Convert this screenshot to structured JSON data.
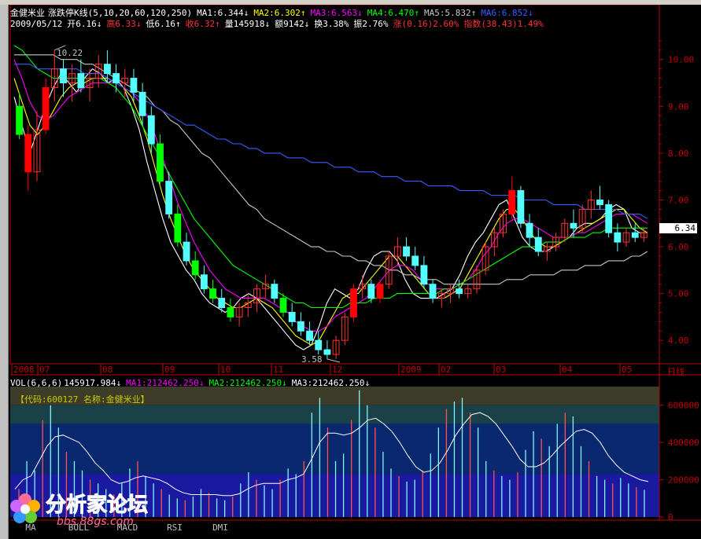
{
  "header": {
    "name": "金健米业",
    "indicator": "涨跌停K线",
    "params": "(5,10,20,60,120,250)",
    "ma1": "MA1:6.344↓",
    "ma2": "MA2:6.302↑",
    "ma3": "MA3:6.563↓",
    "ma4": "MA4:6.470↑",
    "ma5": "MA5:5.832↑",
    "ma6": "MA6:6.852↓",
    "date": "2009/05/12",
    "open": "开6.16↓",
    "high": "高6.33↓",
    "low": "低6.16↑",
    "close": "收6.32↑",
    "volume": "量145918↓",
    "amount": "额9142↓",
    "turnover": "换3.38%",
    "amplitude": "振2.76%",
    "change": "涨(0.16)2.60%",
    "index": "指数(38.43)1.49%"
  },
  "vol_header": {
    "label": "VOL(6,6,6)",
    "value": "145917.984↓",
    "ma1": "MA1:212462.250↓",
    "ma2": "MA2:212462.250↓",
    "ma3": "MA3:212462.250↓"
  },
  "code_label": "【代码:600127 名称:金健米业】",
  "current_price_label": "6.34",
  "max_label": "10.22",
  "min_label": "3.58",
  "period_label": "日线",
  "tabs": [
    "MA",
    "BOLL",
    "MACD",
    "RSI",
    "DMI"
  ],
  "logo": {
    "title": "分析家论坛",
    "url": "bbs.88gs.com"
  },
  "colors": {
    "ma1": "#ffffff",
    "ma2": "#ffff00",
    "ma3": "#ff00ff",
    "ma4": "#00ff00",
    "ma5": "#c8c8c8",
    "ma6": "#3a5cff",
    "up": "#ff3232",
    "down": "#54ffff",
    "limit_up": "#ff0000",
    "limit_down": "#00ff00",
    "axis": "#c00000"
  },
  "chart_data": [
    {
      "type": "candlestick",
      "title": "金健米业 涨跌停K线",
      "ylim": [
        3.5,
        10.6
      ],
      "yticks": [
        4.0,
        5.0,
        6.0,
        7.0,
        8.0,
        9.0,
        10.0
      ],
      "x_labels": [
        "2008",
        "07",
        "08",
        "09",
        "10",
        "11",
        "12",
        "2009",
        "02",
        "03",
        "04",
        "05"
      ],
      "ma_series": [
        {
          "name": "MA1",
          "values": [
            9.2,
            8.6,
            8.0,
            8.5,
            9.0,
            9.4,
            9.7,
            9.5,
            9.3,
            9.6,
            9.8,
            9.7,
            9.5,
            9.6,
            9.4,
            9.0,
            8.5,
            7.8,
            7.2,
            6.6,
            6.1,
            5.8,
            5.5,
            5.3,
            5.0,
            4.8,
            4.7,
            4.6,
            4.7,
            4.9,
            5.0,
            4.9,
            4.7,
            4.5,
            4.3,
            4.1,
            3.9,
            3.8,
            3.9,
            4.3,
            4.8,
            5.1,
            5.0,
            4.9,
            5.1,
            5.5,
            5.8,
            5.9,
            5.9,
            5.7,
            5.3,
            5.0,
            4.9,
            4.9,
            4.9,
            5.0,
            5.1,
            5.4,
            5.8,
            6.1,
            6.3,
            6.6,
            6.9,
            7.0,
            6.6,
            6.2,
            6.0,
            5.9,
            5.9,
            6.0,
            6.1,
            6.2,
            6.4,
            6.5,
            6.5,
            6.6,
            6.8,
            6.9,
            6.8,
            6.4,
            6.3,
            6.3
          ]
        },
        {
          "name": "MA2",
          "values": [
            9.6,
            9.1,
            8.6,
            8.4,
            8.6,
            8.9,
            9.2,
            9.4,
            9.5,
            9.5,
            9.6,
            9.6,
            9.6,
            9.5,
            9.4,
            9.2,
            8.8,
            8.3,
            7.7,
            7.1,
            6.6,
            6.2,
            5.8,
            5.5,
            5.3,
            5.1,
            4.9,
            4.8,
            4.7,
            4.7,
            4.8,
            4.9,
            4.8,
            4.7,
            4.5,
            4.3,
            4.1,
            4.0,
            3.9,
            4.0,
            4.3,
            4.6,
            4.9,
            5.0,
            5.0,
            5.2,
            5.4,
            5.6,
            5.8,
            5.8,
            5.6,
            5.4,
            5.2,
            5.0,
            4.9,
            4.9,
            5.0,
            5.1,
            5.4,
            5.7,
            6.0,
            6.3,
            6.6,
            6.8,
            6.8,
            6.6,
            6.3,
            6.1,
            6.0,
            6.0,
            6.1,
            6.2,
            6.3,
            6.4,
            6.5,
            6.6,
            6.7,
            6.8,
            6.8,
            6.6,
            6.4,
            6.3
          ]
        },
        {
          "name": "MA3",
          "values": [
            10.0,
            9.6,
            9.1,
            8.8,
            8.7,
            8.8,
            9.0,
            9.2,
            9.3,
            9.4,
            9.5,
            9.5,
            9.5,
            9.5,
            9.4,
            9.3,
            9.1,
            8.8,
            8.4,
            7.9,
            7.4,
            6.9,
            6.5,
            6.1,
            5.8,
            5.5,
            5.3,
            5.1,
            5.0,
            4.9,
            4.9,
            4.9,
            4.9,
            4.8,
            4.7,
            4.6,
            4.4,
            4.3,
            4.2,
            4.2,
            4.3,
            4.5,
            4.6,
            4.7,
            4.8,
            4.9,
            5.1,
            5.3,
            5.5,
            5.6,
            5.6,
            5.5,
            5.3,
            5.2,
            5.1,
            5.1,
            5.1,
            5.2,
            5.3,
            5.5,
            5.8,
            6.0,
            6.3,
            6.5,
            6.6,
            6.6,
            6.5,
            6.4,
            6.3,
            6.2,
            6.2,
            6.2,
            6.3,
            6.3,
            6.4,
            6.5,
            6.6,
            6.7,
            6.7,
            6.7,
            6.6,
            6.5
          ]
        },
        {
          "name": "MA4",
          "values": [
            10.3,
            10.2,
            10.0,
            9.8,
            9.7,
            9.6,
            9.6,
            9.6,
            9.6,
            9.6,
            9.6,
            9.6,
            9.5,
            9.4,
            9.2,
            9.0,
            8.7,
            8.4,
            8.1,
            7.8,
            7.5,
            7.2,
            6.9,
            6.6,
            6.4,
            6.2,
            6.0,
            5.8,
            5.6,
            5.5,
            5.4,
            5.3,
            5.2,
            5.1,
            5.0,
            4.9,
            4.8,
            4.8,
            4.7,
            4.7,
            4.7,
            4.7,
            4.7,
            4.8,
            4.8,
            4.8,
            4.9,
            4.9,
            4.9,
            5.0,
            5.0,
            5.0,
            5.0,
            5.0,
            5.0,
            5.1,
            5.1,
            5.2,
            5.3,
            5.4,
            5.5,
            5.6,
            5.7,
            5.8,
            5.9,
            6.0,
            6.0,
            6.0,
            6.1,
            6.1,
            6.1,
            6.2,
            6.2,
            6.2,
            6.3,
            6.3,
            6.4,
            6.4,
            6.4,
            6.4,
            6.4,
            6.4
          ]
        },
        {
          "name": "MA5",
          "values": [
            10.1,
            10.1,
            10.1,
            10.1,
            10.1,
            10.1,
            10.0,
            10.0,
            10.0,
            9.9,
            9.9,
            9.8,
            9.7,
            9.6,
            9.5,
            9.4,
            9.3,
            9.2,
            9.0,
            8.9,
            8.7,
            8.6,
            8.4,
            8.2,
            8.0,
            7.9,
            7.7,
            7.5,
            7.3,
            7.1,
            6.9,
            6.8,
            6.6,
            6.5,
            6.4,
            6.3,
            6.2,
            6.1,
            6.0,
            6.0,
            5.9,
            5.9,
            5.8,
            5.8,
            5.7,
            5.7,
            5.6,
            5.6,
            5.5,
            5.5,
            5.4,
            5.4,
            5.3,
            5.3,
            5.3,
            5.2,
            5.2,
            5.2,
            5.2,
            5.2,
            5.2,
            5.2,
            5.2,
            5.3,
            5.3,
            5.3,
            5.4,
            5.4,
            5.4,
            5.4,
            5.5,
            5.5,
            5.5,
            5.6,
            5.6,
            5.6,
            5.7,
            5.7,
            5.7,
            5.8,
            5.8,
            5.9
          ]
        },
        {
          "name": "MA6",
          "values": [
            9.9,
            9.9,
            9.9,
            9.8,
            9.8,
            9.8,
            9.8,
            9.8,
            9.8,
            9.7,
            9.7,
            9.7,
            9.6,
            9.5,
            9.4,
            9.3,
            9.2,
            9.1,
            9.0,
            8.9,
            8.8,
            8.7,
            8.6,
            8.6,
            8.5,
            8.4,
            8.3,
            8.3,
            8.2,
            8.2,
            8.1,
            8.1,
            8.0,
            8.0,
            8.0,
            7.9,
            7.9,
            7.9,
            7.8,
            7.8,
            7.8,
            7.7,
            7.7,
            7.7,
            7.6,
            7.6,
            7.6,
            7.5,
            7.5,
            7.5,
            7.4,
            7.4,
            7.4,
            7.3,
            7.3,
            7.3,
            7.3,
            7.2,
            7.2,
            7.2,
            7.2,
            7.1,
            7.1,
            7.1,
            7.1,
            7.0,
            7.0,
            7.0,
            7.0,
            6.9,
            6.9,
            6.9,
            6.9,
            6.8,
            6.8,
            6.8,
            6.8,
            6.8,
            6.7,
            6.7,
            6.7,
            6.6
          ]
        }
      ],
      "candles": [
        [
          9.0,
          9.3,
          8.3,
          8.4
        ],
        [
          8.4,
          8.6,
          7.2,
          7.6
        ],
        [
          7.6,
          8.9,
          7.4,
          8.5
        ],
        [
          8.5,
          9.6,
          8.4,
          9.4
        ],
        [
          9.4,
          10.2,
          9.1,
          9.8
        ],
        [
          9.8,
          10.0,
          9.2,
          9.5
        ],
        [
          9.5,
          9.9,
          9.1,
          9.7
        ],
        [
          9.7,
          10.0,
          9.3,
          9.4
        ],
        [
          9.4,
          9.8,
          9.1,
          9.6
        ],
        [
          9.6,
          10.1,
          9.4,
          9.9
        ],
        [
          9.9,
          10.2,
          9.5,
          9.7
        ],
        [
          9.7,
          9.9,
          9.3,
          9.5
        ],
        [
          9.5,
          9.8,
          9.2,
          9.6
        ],
        [
          9.6,
          9.8,
          9.1,
          9.3
        ],
        [
          9.3,
          9.5,
          8.6,
          8.8
        ],
        [
          8.8,
          9.0,
          8.0,
          8.2
        ],
        [
          8.2,
          8.4,
          7.3,
          7.4
        ],
        [
          7.4,
          7.6,
          6.6,
          6.7
        ],
        [
          6.7,
          6.9,
          6.0,
          6.1
        ],
        [
          6.1,
          6.3,
          5.6,
          5.7
        ],
        [
          5.7,
          5.9,
          5.3,
          5.4
        ],
        [
          5.4,
          5.6,
          5.0,
          5.1
        ],
        [
          5.1,
          5.3,
          4.8,
          4.9
        ],
        [
          4.9,
          5.1,
          4.6,
          4.7
        ],
        [
          4.7,
          4.9,
          4.4,
          4.5
        ],
        [
          4.5,
          4.8,
          4.3,
          4.7
        ],
        [
          4.7,
          5.0,
          4.5,
          4.8
        ],
        [
          4.8,
          5.2,
          4.6,
          5.1
        ],
        [
          5.1,
          5.4,
          4.9,
          5.2
        ],
        [
          5.2,
          5.3,
          4.8,
          4.9
        ],
        [
          4.9,
          5.0,
          4.5,
          4.6
        ],
        [
          4.6,
          4.8,
          4.3,
          4.4
        ],
        [
          4.4,
          4.6,
          4.1,
          4.2
        ],
        [
          4.2,
          4.4,
          3.9,
          4.0
        ],
        [
          4.0,
          4.2,
          3.7,
          3.8
        ],
        [
          3.8,
          4.0,
          3.6,
          3.7
        ],
        [
          3.7,
          4.1,
          3.6,
          4.0
        ],
        [
          4.0,
          4.6,
          3.9,
          4.5
        ],
        [
          4.5,
          5.2,
          4.4,
          5.1
        ],
        [
          5.1,
          5.4,
          4.9,
          5.2
        ],
        [
          5.2,
          5.3,
          4.8,
          4.9
        ],
        [
          4.9,
          5.3,
          4.8,
          5.2
        ],
        [
          5.2,
          5.9,
          5.1,
          5.8
        ],
        [
          5.8,
          6.2,
          5.6,
          6.0
        ],
        [
          6.0,
          6.2,
          5.7,
          5.8
        ],
        [
          5.8,
          6.0,
          5.5,
          5.6
        ],
        [
          5.6,
          5.8,
          5.1,
          5.2
        ],
        [
          5.2,
          5.3,
          4.8,
          4.9
        ],
        [
          4.9,
          5.1,
          4.7,
          5.0
        ],
        [
          5.0,
          5.2,
          4.8,
          5.1
        ],
        [
          5.1,
          5.3,
          4.9,
          5.0
        ],
        [
          5.0,
          5.2,
          4.9,
          5.1
        ],
        [
          5.1,
          5.6,
          5.0,
          5.5
        ],
        [
          5.5,
          6.1,
          5.4,
          6.0
        ],
        [
          6.0,
          6.4,
          5.8,
          6.3
        ],
        [
          6.3,
          6.8,
          6.2,
          6.7
        ],
        [
          6.7,
          7.5,
          6.6,
          7.2
        ],
        [
          7.2,
          7.3,
          6.4,
          6.5
        ],
        [
          6.5,
          6.7,
          6.0,
          6.2
        ],
        [
          6.2,
          6.4,
          5.8,
          5.9
        ],
        [
          5.9,
          6.1,
          5.7,
          6.0
        ],
        [
          6.0,
          6.3,
          5.9,
          6.2
        ],
        [
          6.2,
          6.6,
          6.1,
          6.5
        ],
        [
          6.5,
          6.8,
          6.2,
          6.4
        ],
        [
          6.4,
          6.9,
          6.3,
          6.8
        ],
        [
          6.8,
          7.2,
          6.6,
          7.0
        ],
        [
          7.0,
          7.3,
          6.8,
          6.9
        ],
        [
          6.9,
          7.0,
          6.2,
          6.3
        ],
        [
          6.3,
          6.5,
          5.9,
          6.1
        ],
        [
          6.1,
          6.4,
          6.0,
          6.3
        ],
        [
          6.3,
          6.5,
          6.1,
          6.2
        ],
        [
          6.2,
          6.4,
          6.1,
          6.3
        ]
      ],
      "limit_up_idx": [
        1,
        3,
        38,
        41,
        56
      ],
      "limit_down_idx": [
        0,
        16,
        18,
        20,
        22,
        24,
        30
      ]
    },
    {
      "type": "bar",
      "title": "VOL(6,6,6)",
      "ylim": [
        0,
        700000
      ],
      "yticks": [
        0,
        200000,
        400000,
        600000
      ],
      "values": [
        150000,
        300000,
        250000,
        520000,
        600000,
        480000,
        350000,
        300000,
        250000,
        200000,
        180000,
        150000,
        120000,
        180000,
        260000,
        300000,
        220000,
        180000,
        150000,
        120000,
        100000,
        90000,
        110000,
        150000,
        130000,
        100000,
        90000,
        110000,
        180000,
        240000,
        200000,
        170000,
        150000,
        200000,
        260000,
        230000,
        300000,
        560000,
        640000,
        480000,
        300000,
        340000,
        520000,
        680000,
        600000,
        480000,
        350000,
        260000,
        220000,
        190000,
        200000,
        250000,
        340000,
        480000,
        580000,
        620000,
        640000,
        560000,
        480000,
        300000,
        250000,
        220000,
        200000,
        240000,
        360000,
        460000,
        420000,
        380000,
        500000,
        560000,
        540000,
        380000,
        300000,
        220000,
        200000,
        180000,
        210000,
        180000,
        160000,
        145918
      ],
      "ma_values": [
        150000,
        200000,
        220000,
        300000,
        380000,
        430000,
        440000,
        420000,
        400000,
        350000,
        290000,
        250000,
        200000,
        180000,
        190000,
        210000,
        220000,
        210000,
        200000,
        180000,
        150000,
        130000,
        120000,
        120000,
        120000,
        120000,
        115000,
        115000,
        125000,
        150000,
        170000,
        180000,
        180000,
        180000,
        200000,
        210000,
        230000,
        310000,
        400000,
        450000,
        450000,
        440000,
        450000,
        480000,
        520000,
        530000,
        500000,
        460000,
        400000,
        330000,
        270000,
        240000,
        250000,
        290000,
        360000,
        440000,
        500000,
        550000,
        560000,
        540000,
        500000,
        440000,
        380000,
        310000,
        270000,
        270000,
        290000,
        330000,
        380000,
        420000,
        460000,
        470000,
        450000,
        400000,
        330000,
        280000,
        240000,
        220000,
        200000,
        190000
      ]
    }
  ]
}
